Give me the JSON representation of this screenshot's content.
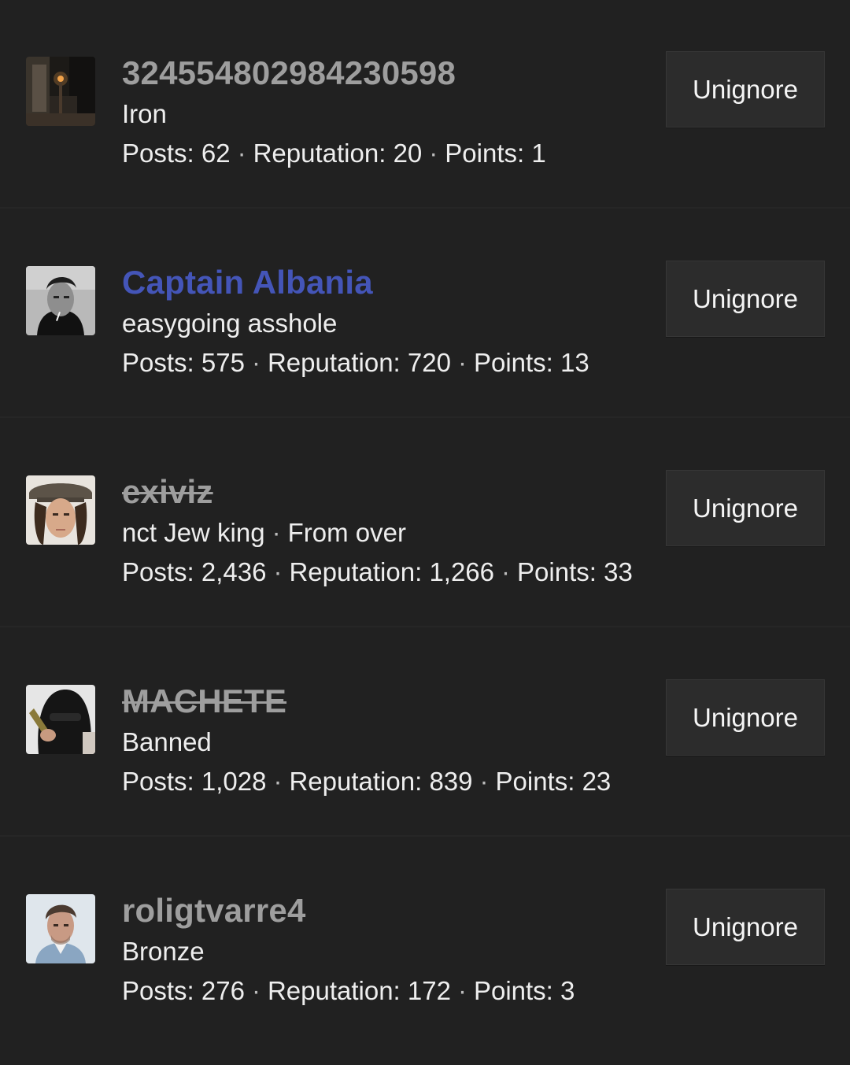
{
  "ignored_users": [
    {
      "username": "324554802984230598",
      "title": "Iron",
      "posts_label": "Posts:",
      "posts": "62",
      "reputation_label": "Reputation:",
      "reputation": "20",
      "points_label": "Points:",
      "points": "1",
      "button_label": "Unignore",
      "avatar": "dark-photo-avatar"
    },
    {
      "username": "Captain Albania",
      "title": "easygoing asshole",
      "posts_label": "Posts:",
      "posts": "575",
      "reputation_label": "Reputation:",
      "reputation": "720",
      "points_label": "Points:",
      "points": "13",
      "button_label": "Unignore",
      "avatar": "bw-portrait-avatar"
    },
    {
      "username": "exiviz",
      "title": "nct Jew king",
      "location": "From over",
      "posts_label": "Posts:",
      "posts": "2,436",
      "reputation_label": "Reputation:",
      "reputation": "1,266",
      "points_label": "Points:",
      "points": "33",
      "button_label": "Unignore",
      "avatar": "hat-portrait-avatar"
    },
    {
      "username": "MACHETE",
      "title": "Banned",
      "posts_label": "Posts:",
      "posts": "1,028",
      "reputation_label": "Reputation:",
      "reputation": "839",
      "points_label": "Points:",
      "points": "23",
      "button_label": "Unignore",
      "avatar": "masked-person-avatar"
    },
    {
      "username": "roligtvarre4",
      "title": "Bronze",
      "posts_label": "Posts:",
      "posts": "276",
      "reputation_label": "Reputation:",
      "reputation": "172",
      "points_label": "Points:",
      "points": "3",
      "button_label": "Unignore",
      "avatar": "man-portrait-avatar"
    }
  ],
  "colors": {
    "background": "#212121",
    "username_default": "#9e9e9e",
    "username_staff": "#4455b8",
    "text": "#eeeeee",
    "button_bg": "#2c2c2c"
  }
}
